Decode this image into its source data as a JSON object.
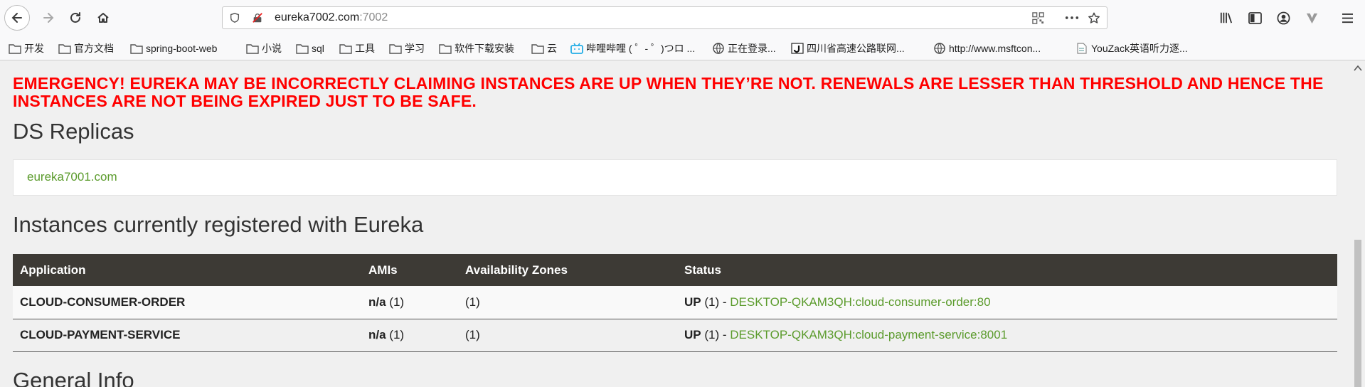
{
  "browser": {
    "url_host": "eureka7002.com",
    "url_port": ":7002",
    "bookmarks": [
      "开发",
      "官方文档",
      "spring-boot-web",
      "小说",
      "sql",
      "工具",
      "学习",
      "软件下载安装",
      "云",
      "哔哩哔哩 ( ゜- ゜)つロ ...",
      "正在登录...",
      "四川省高速公路联网...",
      "http://www.msftcon...",
      "YouZack英语听力逐..."
    ]
  },
  "page": {
    "emergency": "EMERGENCY! EUREKA MAY BE INCORRECTLY CLAIMING INSTANCES ARE UP WHEN THEY’RE NOT. RENEWALS ARE LESSER THAN THRESHOLD AND HENCE THE INSTANCES ARE NOT BEING EXPIRED JUST TO BE SAFE.",
    "ds_title": "DS Replicas",
    "replica": "eureka7001.com",
    "instances_title": "Instances currently registered with Eureka",
    "columns": [
      "Application",
      "AMIs",
      "Availability Zones",
      "Status"
    ],
    "rows": [
      {
        "application": "CLOUD-CONSUMER-ORDER",
        "ami_bold": "n/a",
        "ami_count": "(1)",
        "zones": "(1)",
        "status_bold": "UP",
        "status_count": "(1) -",
        "status_link": "DESKTOP-QKAM3QH:cloud-consumer-order:80"
      },
      {
        "application": "CLOUD-PAYMENT-SERVICE",
        "ami_bold": "n/a",
        "ami_count": "(1)",
        "zones": "(1)",
        "status_bold": "UP",
        "status_count": "(1) -",
        "status_link": "DESKTOP-QKAM3QH:cloud-payment-service:8001"
      }
    ],
    "general_title": "General Info"
  },
  "colors": {
    "emergency": "#ff0000",
    "link_green": "#5b9b2c",
    "table_header": "#3d3a35"
  }
}
